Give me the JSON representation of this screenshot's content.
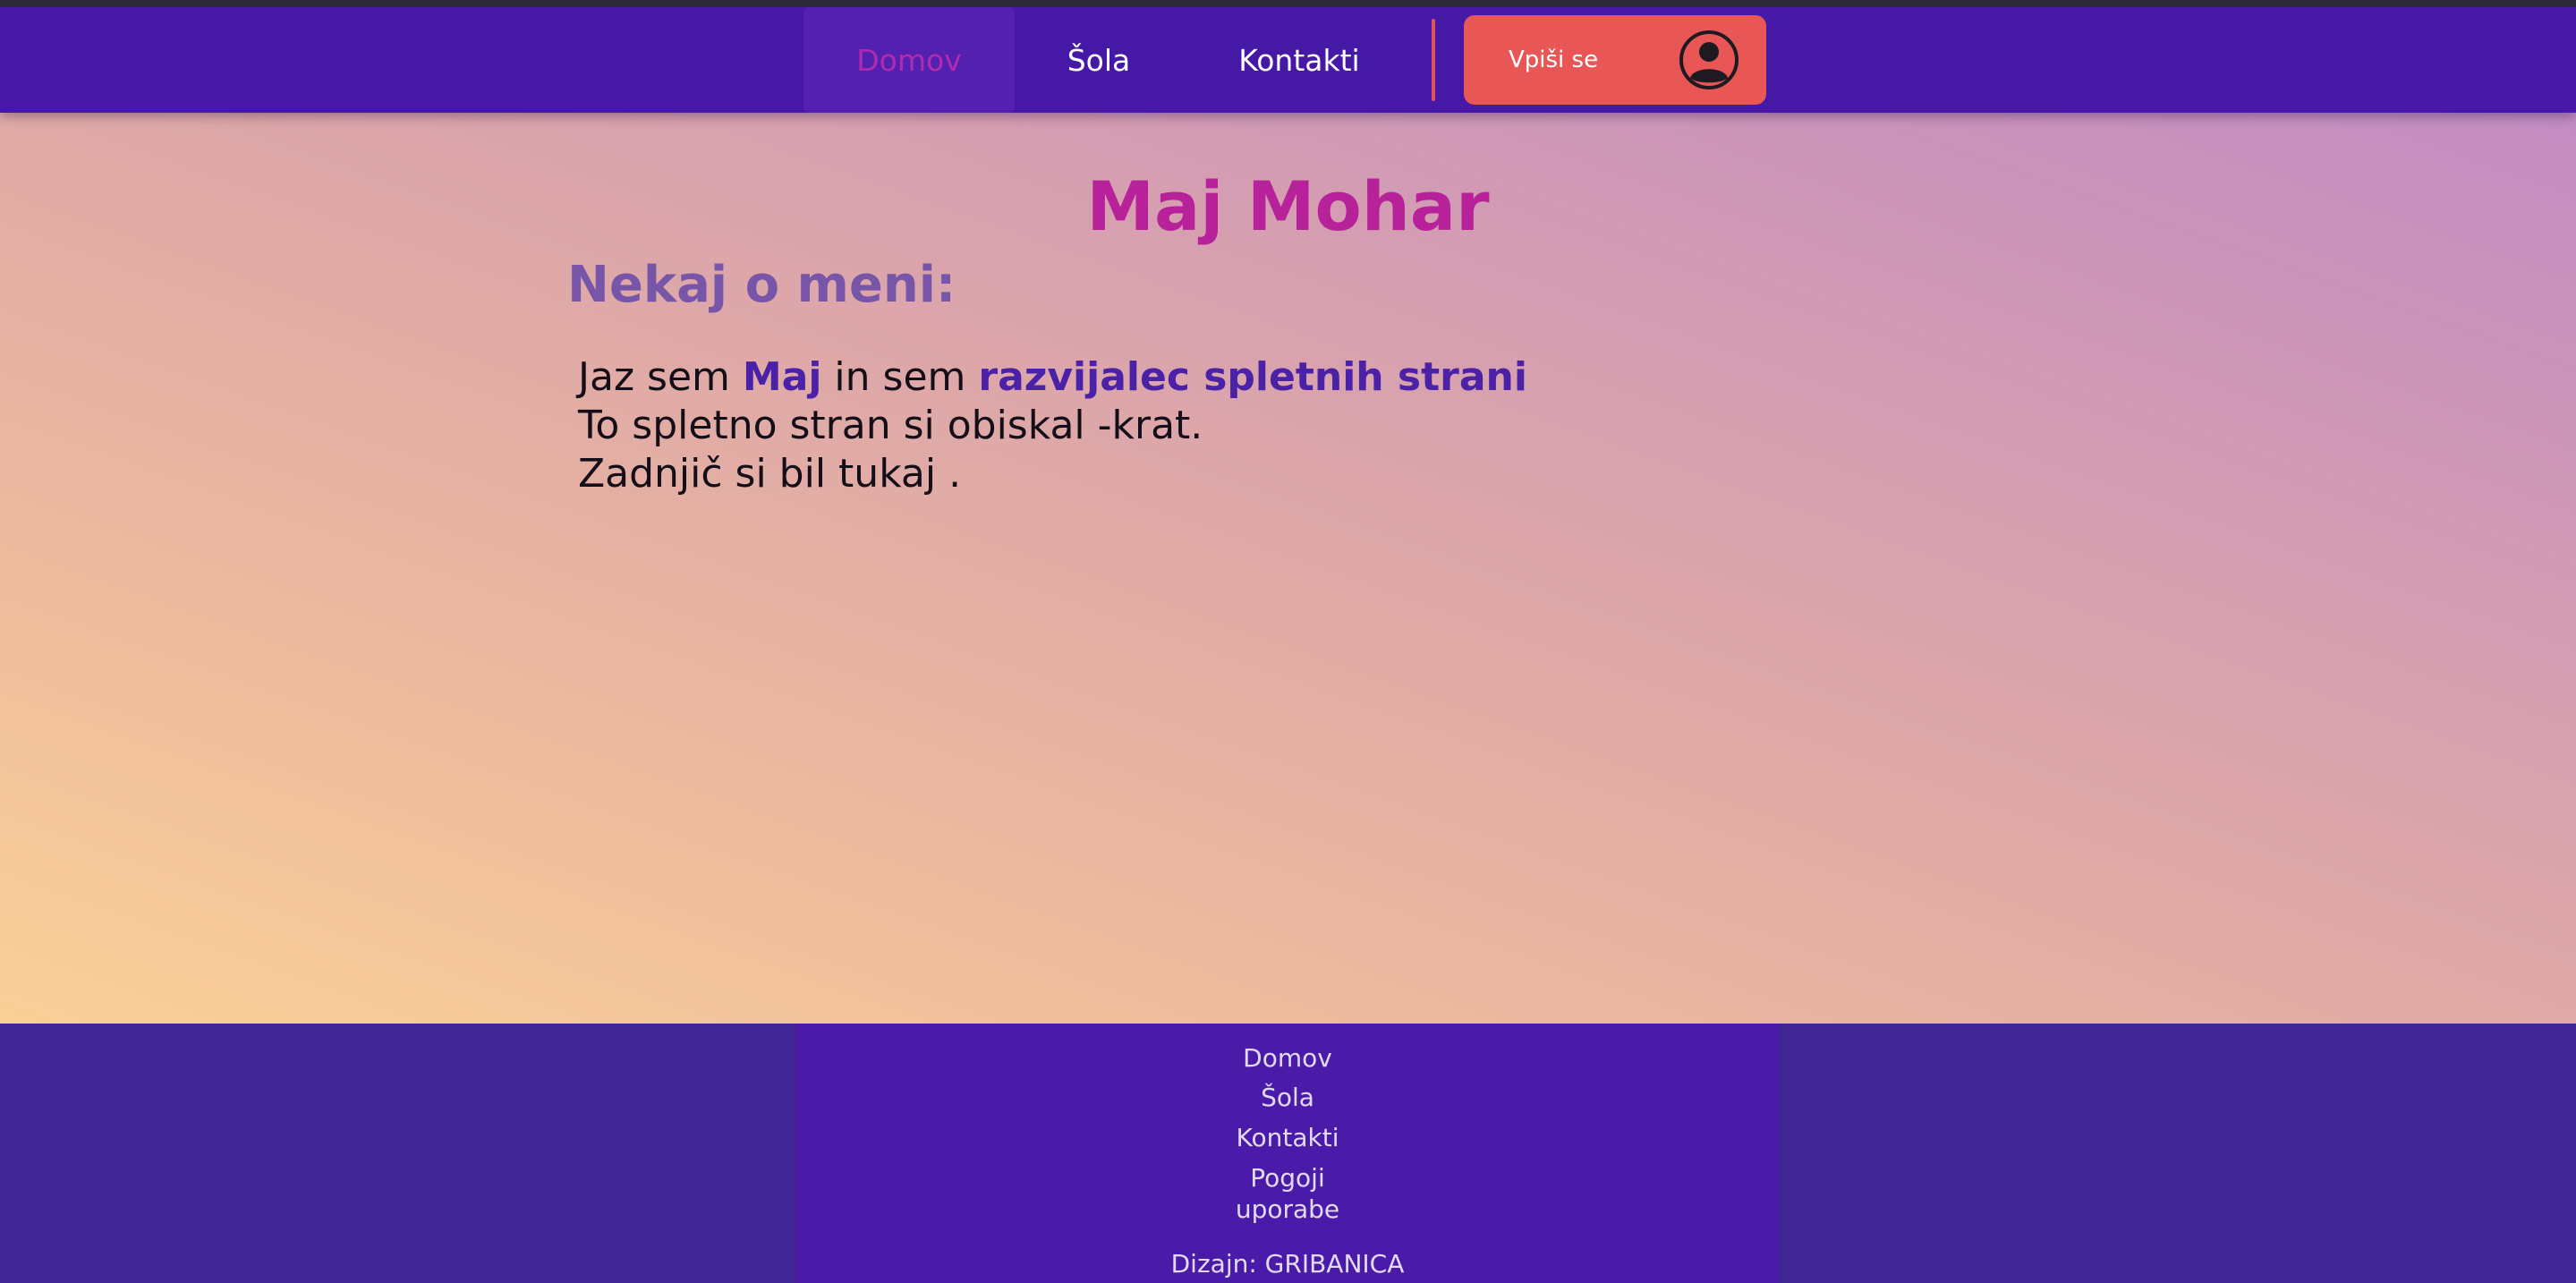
{
  "nav": {
    "items": [
      {
        "label": "Domov"
      },
      {
        "label": "Šola"
      },
      {
        "label": "Kontakti"
      }
    ],
    "signup_label": "Vpiši se",
    "signup_icon": "user-icon"
  },
  "main": {
    "title": "Maj Mohar",
    "subtitle": "Nekaj o meni:",
    "line1": {
      "part1": "Jaz sem ",
      "name": "Maj",
      "part2": " in sem ",
      "role": "razvijalec spletnih strani"
    },
    "line2": "To spletno stran si obiskal -krat.",
    "line3": "Zadnjič si bil tukaj ."
  },
  "footer": {
    "links": [
      {
        "label": "Domov"
      },
      {
        "label": "Šola"
      },
      {
        "label": "Kontakti"
      },
      {
        "label_line1": "Pogoji",
        "label_line2": "uporabe"
      }
    ],
    "design_credit": "Dizajn: GRIBANICA"
  },
  "colors": {
    "nav_bg": "#4519a6",
    "nav_active": "#b02bb0",
    "signup_bg": "#e85656",
    "title": "#b7229b",
    "subtitle": "#7755a8",
    "highlight": "#4a21a7",
    "footer_bg": "#3f2596"
  }
}
